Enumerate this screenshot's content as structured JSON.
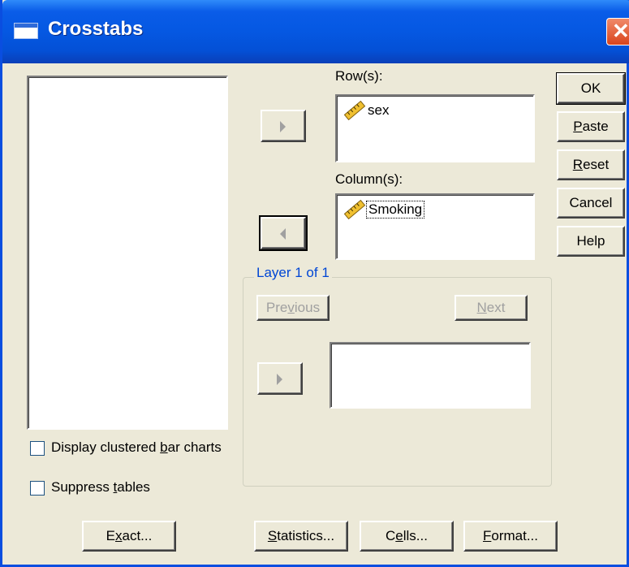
{
  "window": {
    "title": "Crosstabs",
    "close_glyph": "✕"
  },
  "rows": {
    "label": "Row(s):",
    "items": [
      {
        "name": "sex",
        "icon": "scale-ruler-icon"
      }
    ]
  },
  "columns": {
    "label": "Column(s):",
    "items": [
      {
        "name": "Smoking",
        "icon": "scale-ruler-icon"
      }
    ]
  },
  "layer": {
    "label": "Layer 1 of 1",
    "previous_label": "Previous",
    "next_label": "Next"
  },
  "buttons": {
    "ok": "OK",
    "paste": "Paste",
    "reset": "Reset",
    "cancel": "Cancel",
    "help": "Help",
    "exact": "Exact...",
    "statistics": "Statistics...",
    "cells": "Cells...",
    "format": "Format..."
  },
  "options": {
    "clustered_bar": {
      "label": "Display clustered bar charts",
      "checked": false
    },
    "suppress_tables": {
      "label": "Suppress tables",
      "checked": false
    }
  },
  "colors": {
    "title_bar": "#0558e2",
    "dialog_bg": "#ece9d8",
    "group_label": "#0046d5"
  }
}
